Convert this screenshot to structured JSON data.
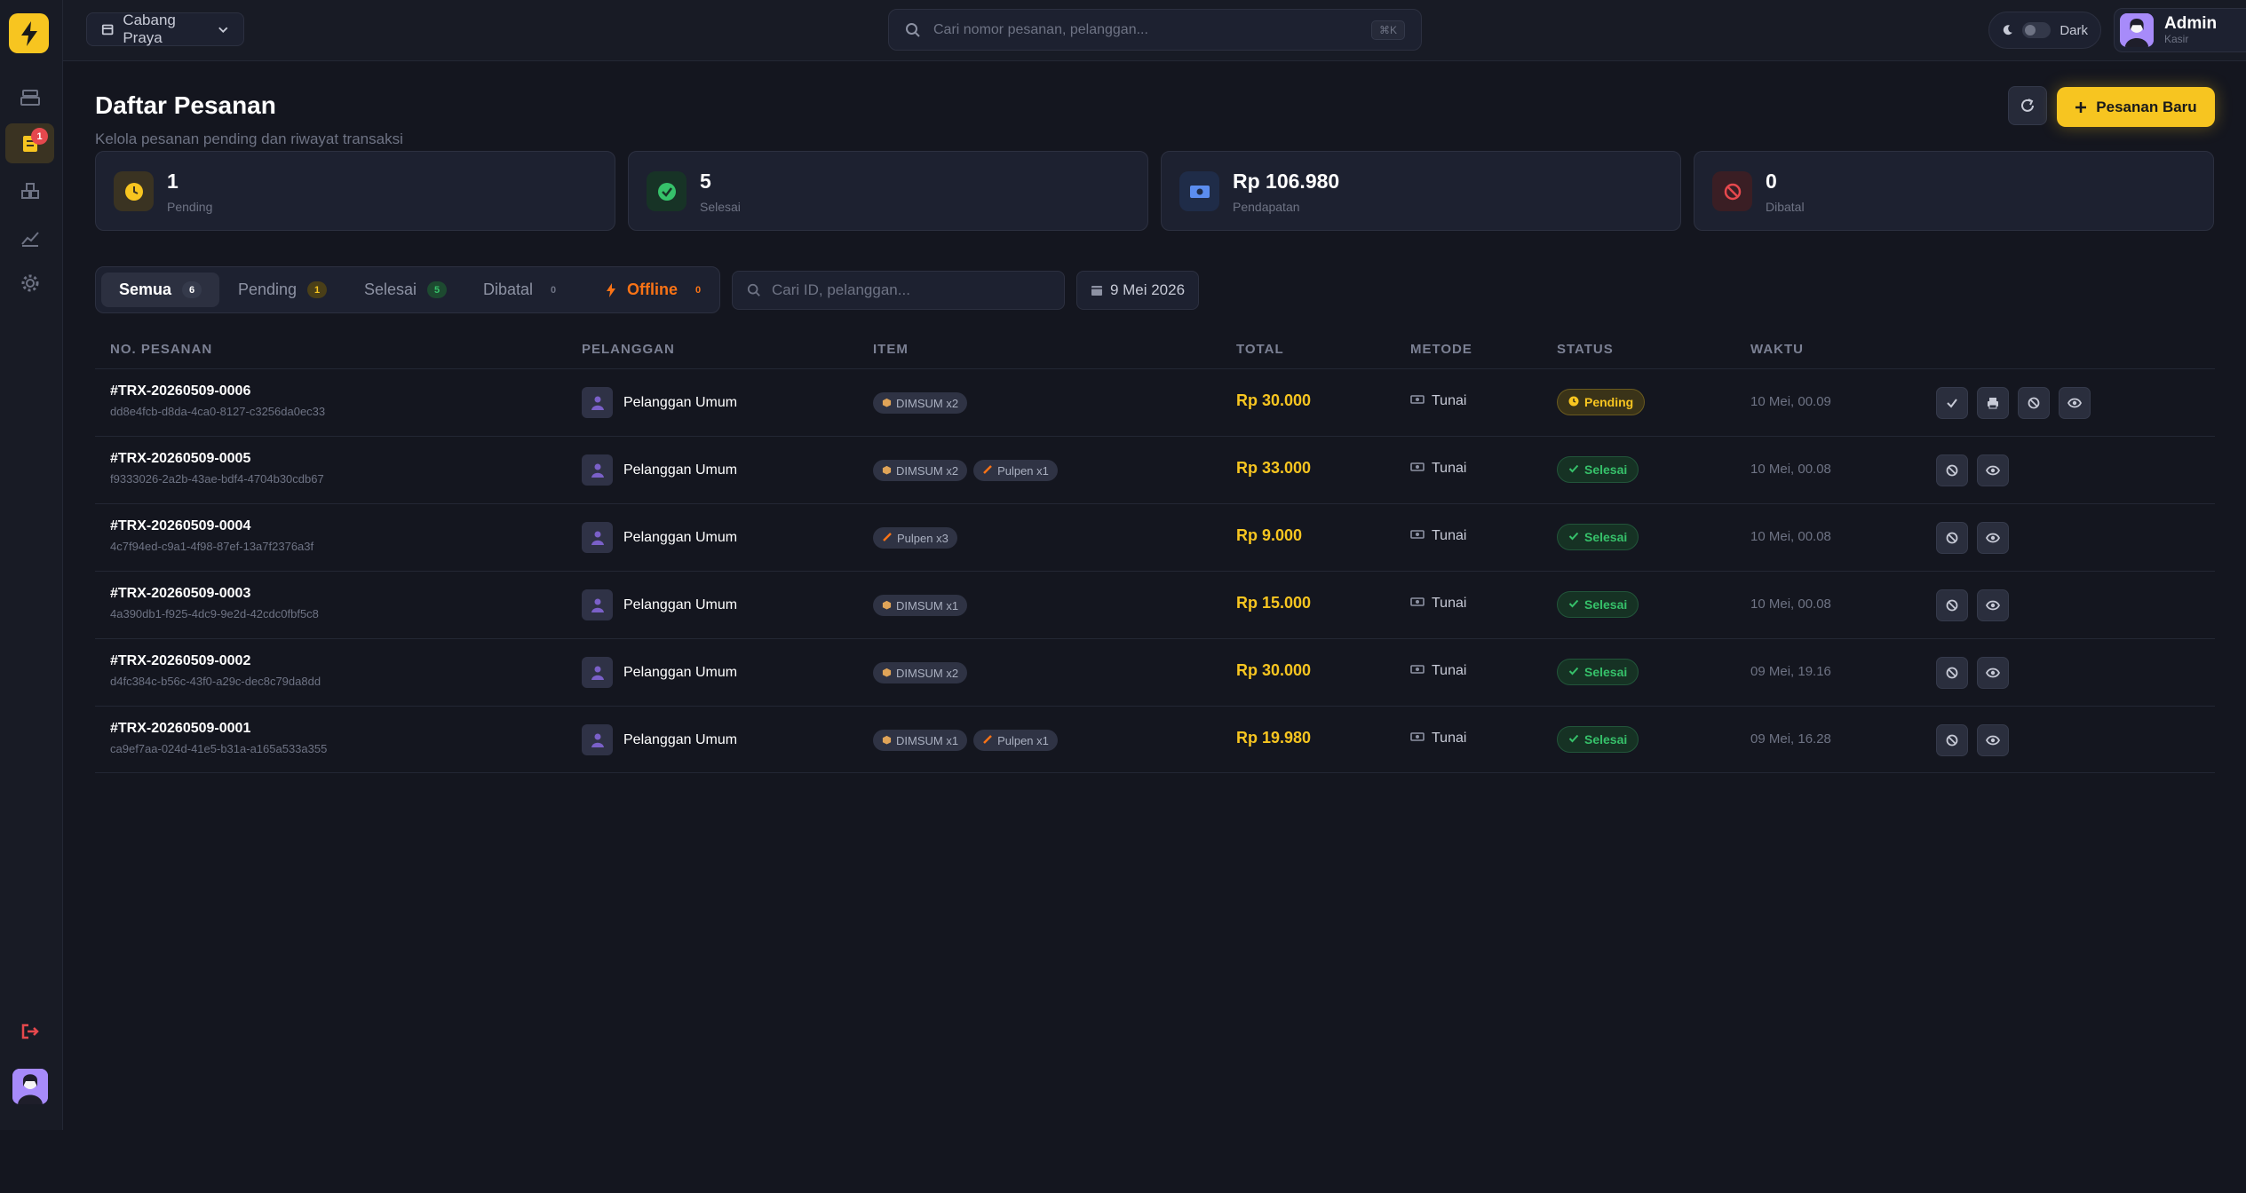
{
  "app": {
    "brand_color": "#f7c520"
  },
  "header": {
    "branch_label": "Cabang Praya",
    "search_placeholder": "Cari nomor pesanan, pelanggan...",
    "search_shortcut": "⌘K",
    "theme_label": "Dark",
    "user_name": "Admin",
    "user_role": "Kasir"
  },
  "sidebar": {
    "orders_badge": "1"
  },
  "page": {
    "title": "Daftar Pesanan",
    "subtitle": "Kelola pesanan pending dan riwayat transaksi",
    "new_order_label": "Pesanan Baru"
  },
  "stats": [
    {
      "value": "1",
      "label": "Pending"
    },
    {
      "value": "5",
      "label": "Selesai"
    },
    {
      "value": "Rp 106.980",
      "label": "Pendapatan"
    },
    {
      "value": "0",
      "label": "Dibatal"
    }
  ],
  "tabs": [
    {
      "label": "Semua",
      "count": "6"
    },
    {
      "label": "Pending",
      "count": "1"
    },
    {
      "label": "Selesai",
      "count": "5"
    },
    {
      "label": "Dibatal",
      "count": "0"
    },
    {
      "label": "Offline",
      "count": "0"
    }
  ],
  "filter": {
    "search_placeholder": "Cari ID, pelanggan...",
    "date": "9 Mei 2026"
  },
  "table": {
    "headers": [
      "NO. PESANAN",
      "PELANGGAN",
      "ITEM",
      "TOTAL",
      "METODE",
      "STATUS",
      "WAKTU"
    ],
    "rows": [
      {
        "id": "#TRX-20260509-0006",
        "uuid": "dd8e4fcb-d8da-4ca0-8127-c3256da0ec33",
        "customer": "Pelanggan Umum",
        "item1": "DIMSUM x2",
        "item2": "",
        "total": "Rp 30.000",
        "method": "Tunai",
        "status": "Pending",
        "time": "10 Mei, 00.09"
      },
      {
        "id": "#TRX-20260509-0005",
        "uuid": "f9333026-2a2b-43ae-bdf4-4704b30cdb67",
        "customer": "Pelanggan Umum",
        "item1": "DIMSUM x2",
        "item2": "Pulpen x1",
        "total": "Rp 33.000",
        "method": "Tunai",
        "status": "Selesai",
        "time": "10 Mei, 00.08"
      },
      {
        "id": "#TRX-20260509-0004",
        "uuid": "4c7f94ed-c9a1-4f98-87ef-13a7f2376a3f",
        "customer": "Pelanggan Umum",
        "item1": "Pulpen x3",
        "item2": "",
        "total": "Rp 9.000",
        "method": "Tunai",
        "status": "Selesai",
        "time": "10 Mei, 00.08"
      },
      {
        "id": "#TRX-20260509-0003",
        "uuid": "4a390db1-f925-4dc9-9e2d-42cdc0fbf5c8",
        "customer": "Pelanggan Umum",
        "item1": "DIMSUM x1",
        "item2": "",
        "total": "Rp 15.000",
        "method": "Tunai",
        "status": "Selesai",
        "time": "10 Mei, 00.08"
      },
      {
        "id": "#TRX-20260509-0002",
        "uuid": "d4fc384c-b56c-43f0-a29c-dec8c79da8dd",
        "customer": "Pelanggan Umum",
        "item1": "DIMSUM x2",
        "item2": "",
        "total": "Rp 30.000",
        "method": "Tunai",
        "status": "Selesai",
        "time": "09 Mei, 19.16"
      },
      {
        "id": "#TRX-20260509-0001",
        "uuid": "ca9ef7aa-024d-41e5-b31a-a165a533a355",
        "customer": "Pelanggan Umum",
        "item1": "DIMSUM x1",
        "item2": "Pulpen x1",
        "total": "Rp 19.980",
        "method": "Tunai",
        "status": "Selesai",
        "time": "09 Mei, 16.28"
      }
    ]
  }
}
